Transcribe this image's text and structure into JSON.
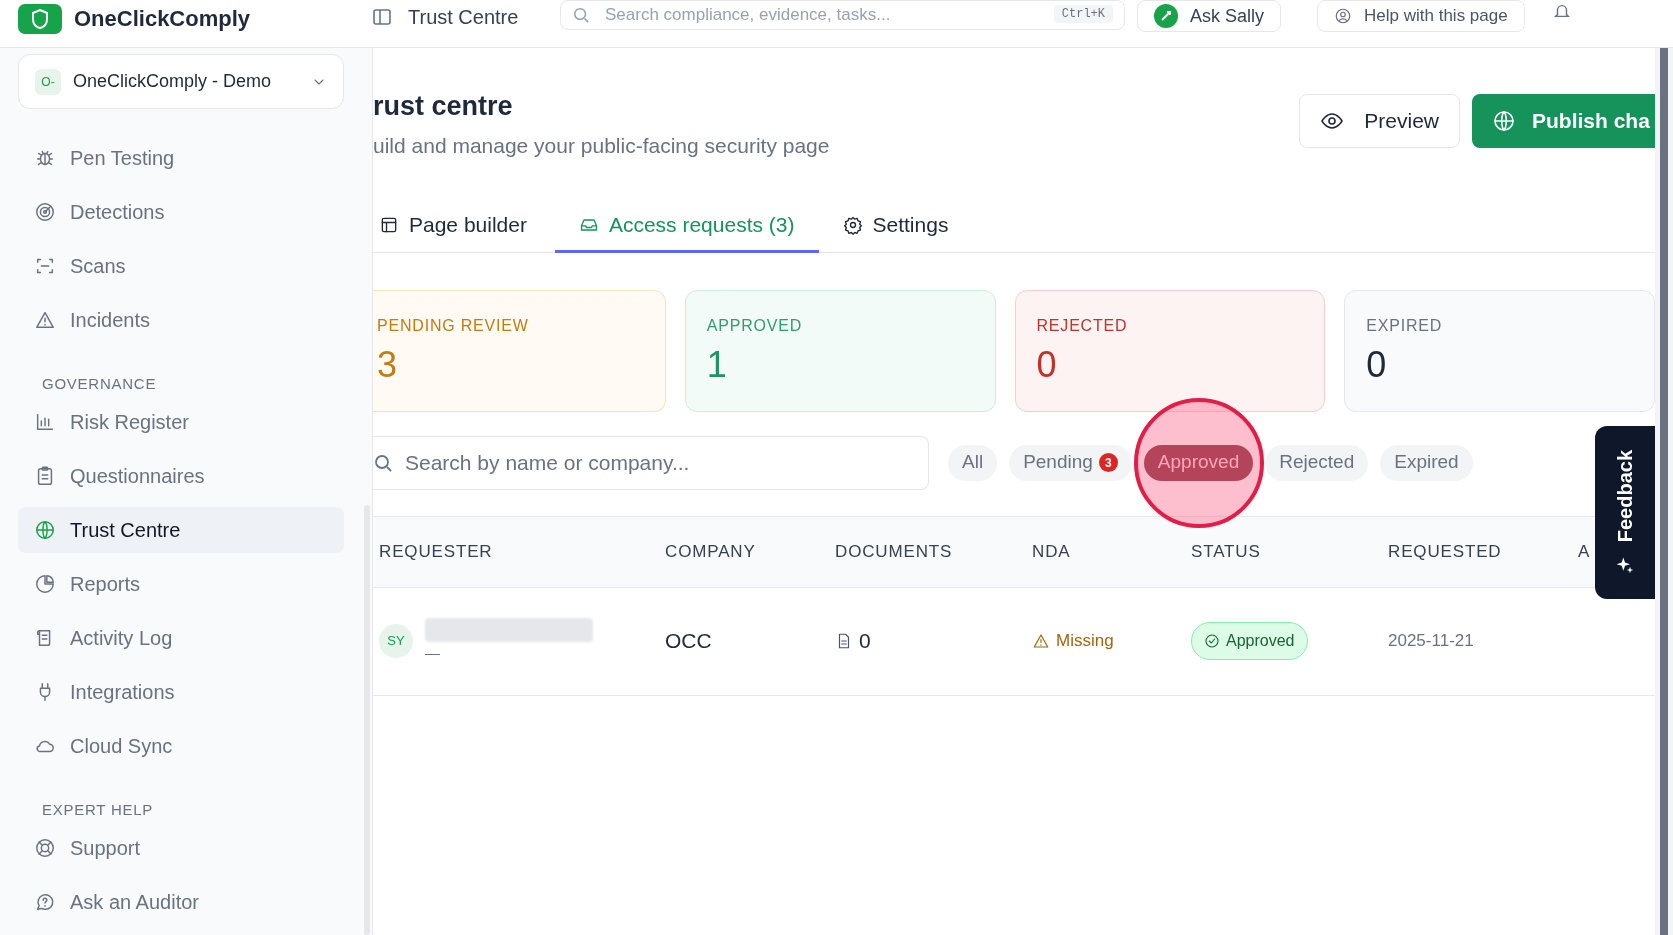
{
  "header": {
    "brand": "OneClickComply",
    "page": "Trust Centre",
    "search": {
      "placeholder": "Search compliance, evidence, tasks..."
    },
    "shortcut": "Ctrl+K",
    "ask": "Ask Sally",
    "help": "Help with this page"
  },
  "sidebar": {
    "org": "OneClickComply - Demo",
    "org_badge": "O-",
    "sections": [
      {
        "items": [
          {
            "label": "Pen Testing",
            "selected": false
          },
          {
            "label": "Detections",
            "selected": false
          },
          {
            "label": "Scans",
            "selected": false
          },
          {
            "label": "Incidents",
            "selected": false
          }
        ]
      },
      {
        "heading": "GOVERNANCE",
        "items": [
          {
            "label": "Risk Register",
            "selected": false
          },
          {
            "label": "Questionnaires",
            "selected": false
          },
          {
            "label": "Trust Centre",
            "selected": true
          },
          {
            "label": "Reports",
            "selected": false
          },
          {
            "label": "Activity Log",
            "selected": false
          },
          {
            "label": "Integrations",
            "selected": false
          },
          {
            "label": "Cloud Sync",
            "selected": false
          }
        ]
      },
      {
        "heading": "EXPERT HELP",
        "items": [
          {
            "label": "Support",
            "selected": false
          },
          {
            "label": "Ask an Auditor",
            "selected": false
          }
        ]
      }
    ]
  },
  "page": {
    "title": "rust centre",
    "subtitle": "uild and manage your public-facing security page",
    "actions": [
      {
        "kind": "secondary",
        "label": "Preview"
      },
      {
        "kind": "primary",
        "label": "Publish cha"
      }
    ]
  },
  "tabs": [
    {
      "label": "Page builder",
      "selected": false
    },
    {
      "label": "Access requests (3)",
      "selected": true
    },
    {
      "label": "Settings",
      "selected": false
    }
  ],
  "stats": [
    {
      "kind": "pending",
      "label": "PENDING REVIEW",
      "value": "3"
    },
    {
      "kind": "approved",
      "label": "APPROVED",
      "value": "1"
    },
    {
      "kind": "rejected",
      "label": "REJECTED",
      "value": "0"
    },
    {
      "kind": "expired",
      "label": "EXPIRED",
      "value": "0"
    }
  ],
  "search": {
    "placeholder": "Search by name or company..."
  },
  "filters": [
    {
      "label": "All",
      "selected": false,
      "clicked": false
    },
    {
      "label": "Pending",
      "count": "3",
      "selected": false,
      "clicked": false
    },
    {
      "label": "Approved",
      "selected": true,
      "clicked": true
    },
    {
      "label": "Rejected",
      "selected": false,
      "clicked": false
    },
    {
      "label": "Expired",
      "selected": false,
      "clicked": false
    }
  ],
  "table": {
    "columns": [
      "REQUESTER",
      "COMPANY",
      "DOCUMENTS",
      "NDA",
      "STATUS",
      "REQUESTED",
      "A"
    ],
    "rows": [
      {
        "avatar": "SY",
        "name_redacted": true,
        "detail": "—",
        "company": "OCC",
        "documents": "0",
        "nda": {
          "kind": "missing",
          "label": "Missing"
        },
        "status": {
          "kind": "approved",
          "label": "Approved"
        },
        "requested": "2025-11-21"
      }
    ]
  },
  "feedback": {
    "label": "Feedback"
  }
}
